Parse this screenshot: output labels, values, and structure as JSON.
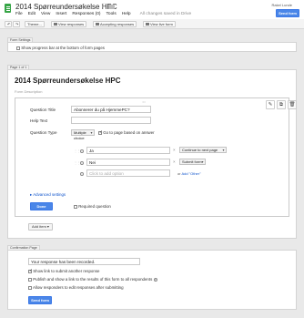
{
  "header": {
    "title": "2014 Spørreundersøkelse HPC",
    "user": "Rakel Lunde",
    "send_form": "Send form",
    "menu": [
      "File",
      "Edit",
      "View",
      "Insert",
      "Responses (0)",
      "Tools",
      "Help"
    ],
    "saved_status": "All changes saved in Drive"
  },
  "toolbar": {
    "theme": "Theme...",
    "view_responses": "View responses",
    "accepting_responses": "Accepting responses",
    "view_live_form": "View live form"
  },
  "form_settings": {
    "tab": "Form Settings",
    "progress_bar": "Show progress bar at the bottom of form pages"
  },
  "page": {
    "tab": "Page 1 of 1",
    "title": "2014 Spørreundersøkelse HPC",
    "description_placeholder": "Form Description"
  },
  "question": {
    "title_label": "Question Title",
    "title_value": "Abonnerer du på HjemmePC?",
    "help_label": "Help Text",
    "type_label": "Question Type",
    "type_value": "Multiple choice",
    "go_to_page": "Go to page based on answer",
    "options": [
      {
        "label": "Ja",
        "target": "Continue to next page"
      },
      {
        "label": "Nei",
        "target": "Submit form"
      }
    ],
    "add_option_placeholder": "Click to add option",
    "or_text": "or",
    "add_other": "Add \"Other\"",
    "advanced": "Advanced settings",
    "done": "Done",
    "required": "Required question"
  },
  "add_item": "Add item",
  "confirmation": {
    "tab": "Confirmation Page",
    "message": "Your response has been recorded.",
    "show_link": "Show link to submit another response",
    "publish": "Publish and show a link to the results of this form to all respondents",
    "allow_edit": "Allow responders to edit responses after submitting",
    "send_form": "Send form"
  }
}
